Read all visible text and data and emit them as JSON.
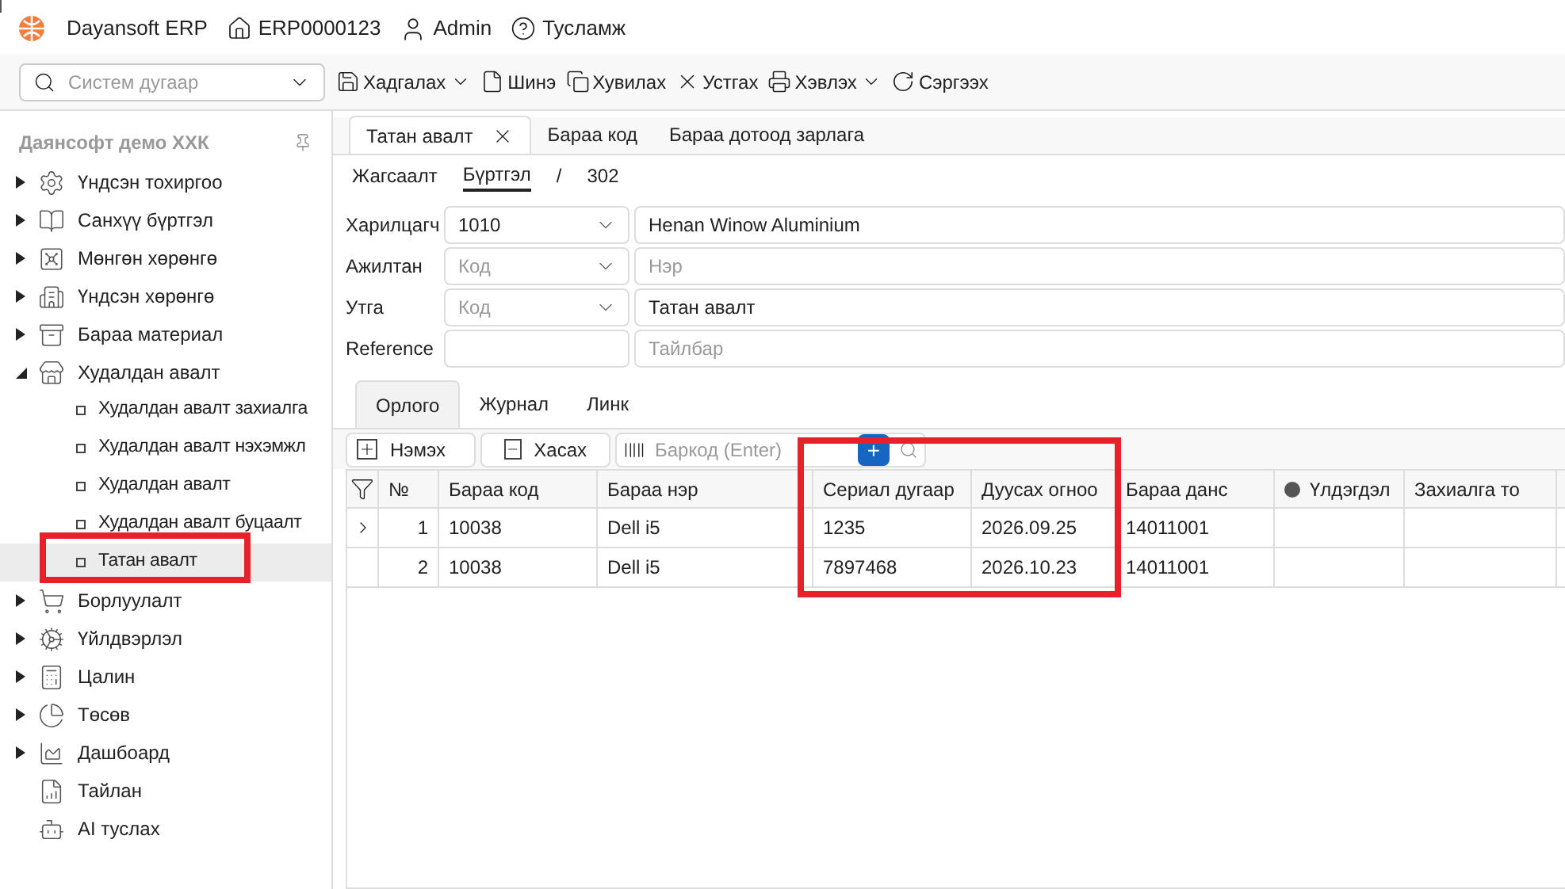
{
  "topbar": {
    "app": "Dayansoft ERP",
    "record": "ERP0000123",
    "user": "Admin",
    "help": "Тусламж"
  },
  "search": {
    "placeholder": "Систем дугаар"
  },
  "toolbar": [
    {
      "label": "Хадгалах",
      "dropdown": true
    },
    {
      "label": "Шинэ",
      "dropdown": false
    },
    {
      "label": "Хувилах",
      "dropdown": false
    },
    {
      "label": "Устгах",
      "dropdown": false
    },
    {
      "label": "Хэвлэх",
      "dropdown": true
    },
    {
      "label": "Сэргээх",
      "dropdown": false
    }
  ],
  "sidebar": {
    "company": "Даянсофт демо ХХК",
    "items": [
      {
        "label": "Үндсэн тохиргоо",
        "expanded": false,
        "selected": false
      },
      {
        "label": "Санхүү бүртгэл",
        "expanded": false,
        "selected": false
      },
      {
        "label": "Мөнгөн хөрөнгө",
        "expanded": false,
        "selected": false
      },
      {
        "label": "Үндсэн хөрөнгө",
        "expanded": false,
        "selected": false
      },
      {
        "label": "Бараа материал",
        "expanded": false,
        "selected": false
      },
      {
        "label": "Худалдан авалт",
        "expanded": true,
        "selected": false,
        "children": [
          {
            "label": "Худалдан авалт захиалга",
            "selected": false
          },
          {
            "label": "Худалдан авалт нэхэмжл",
            "selected": false
          },
          {
            "label": "Худалдан авалт",
            "selected": false
          },
          {
            "label": "Худалдан авалт буцаалт",
            "selected": false
          },
          {
            "label": "Татан авалт",
            "selected": true
          }
        ]
      },
      {
        "label": "Борлуулалт",
        "expanded": false,
        "selected": false
      },
      {
        "label": "Үйлдвэрлэл",
        "expanded": false,
        "selected": false
      },
      {
        "label": "Цалин",
        "expanded": false,
        "selected": false
      },
      {
        "label": "Төсөв",
        "expanded": false,
        "selected": false
      },
      {
        "label": "Дашбоард",
        "expanded": false,
        "selected": false
      },
      {
        "label": "Тайлан",
        "selected": false
      },
      {
        "label": "AI туслах",
        "selected": false
      }
    ]
  },
  "tabs": [
    {
      "label": "Татан авалт",
      "selected": true
    },
    {
      "label": "Бараа код",
      "selected": false
    },
    {
      "label": "Бараа дотоод зарлага",
      "selected": false
    }
  ],
  "breadcrumb": [
    {
      "label": "Жагсаалт",
      "selected": false
    },
    {
      "label": "Бүртгэл",
      "selected": true
    },
    {
      "label": "/",
      "selected": false
    },
    {
      "label": "302",
      "selected": false
    }
  ],
  "form": [
    {
      "label": "Харилцагч",
      "code": {
        "value": "1010"
      },
      "name": {
        "value": "Henan Winow Aluminium"
      },
      "dropdown": true
    },
    {
      "label": "Ажилтан",
      "code": {
        "placeholder": "Код"
      },
      "name": {
        "placeholder": "Нэр"
      },
      "dropdown": true
    },
    {
      "label": "Утга",
      "code": {
        "placeholder": "Код"
      },
      "name": {
        "value": "Татан авалт"
      },
      "dropdown": true
    },
    {
      "label": "Reference",
      "name": {
        "placeholder": "Тайлбар"
      },
      "dropdown": false
    }
  ],
  "subtabs": [
    {
      "label": "Орлого",
      "selected": true
    },
    {
      "label": "Журнал",
      "selected": false
    },
    {
      "label": "Линк",
      "selected": false
    }
  ],
  "grid_toolbar": {
    "add": "Нэмэх",
    "remove": "Хасах",
    "barcode_placeholder": "Баркод (Enter)",
    "plus": "+"
  },
  "table": {
    "columns": [
      "№",
      "Бараа код",
      "Бараа нэр",
      "Сериал дугаар",
      "Дуусах огноо",
      "Бараа данс",
      "Үлдэгдэл",
      "Захиалга то"
    ],
    "rows": [
      {
        "selected": true,
        "cells": [
          "1",
          "10038",
          "Dell i5",
          "1235",
          "2026.09.25",
          "14011001",
          "",
          ""
        ]
      },
      {
        "selected": false,
        "cells": [
          "2",
          "10038",
          "Dell i5",
          "7897468",
          "2026.10.23",
          "14011001",
          "",
          ""
        ]
      }
    ]
  }
}
